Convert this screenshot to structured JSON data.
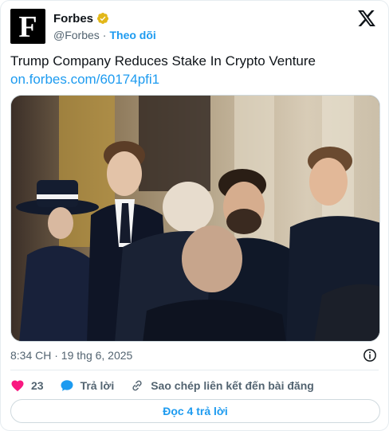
{
  "account": {
    "logo_letter": "F",
    "display_name": "Forbes",
    "handle": "@Forbes",
    "separator": "·",
    "follow_label": "Theo dõi"
  },
  "tweet": {
    "text": "Trump Company Reduces Stake In Crypto Venture",
    "link": "on.forbes.com/60174pfi1",
    "timestamp": "8:34 CH · 19 thg 6, 2025"
  },
  "actions": {
    "like_count": "23",
    "reply_label": "Trả lời",
    "copy_link_label": "Sao chép liên kết đến bài đăng",
    "read_replies_label": "Đọc 4 trả lời"
  },
  "colors": {
    "accent": "#1d9bf0",
    "like": "#f91880",
    "verified": "#e2b719",
    "muted": "#536471"
  },
  "icons": {
    "verified": "verified-badge-icon",
    "x": "x-logo-icon",
    "info": "info-icon",
    "like": "heart-icon",
    "reply": "speech-bubble-icon",
    "copy": "link-icon"
  }
}
